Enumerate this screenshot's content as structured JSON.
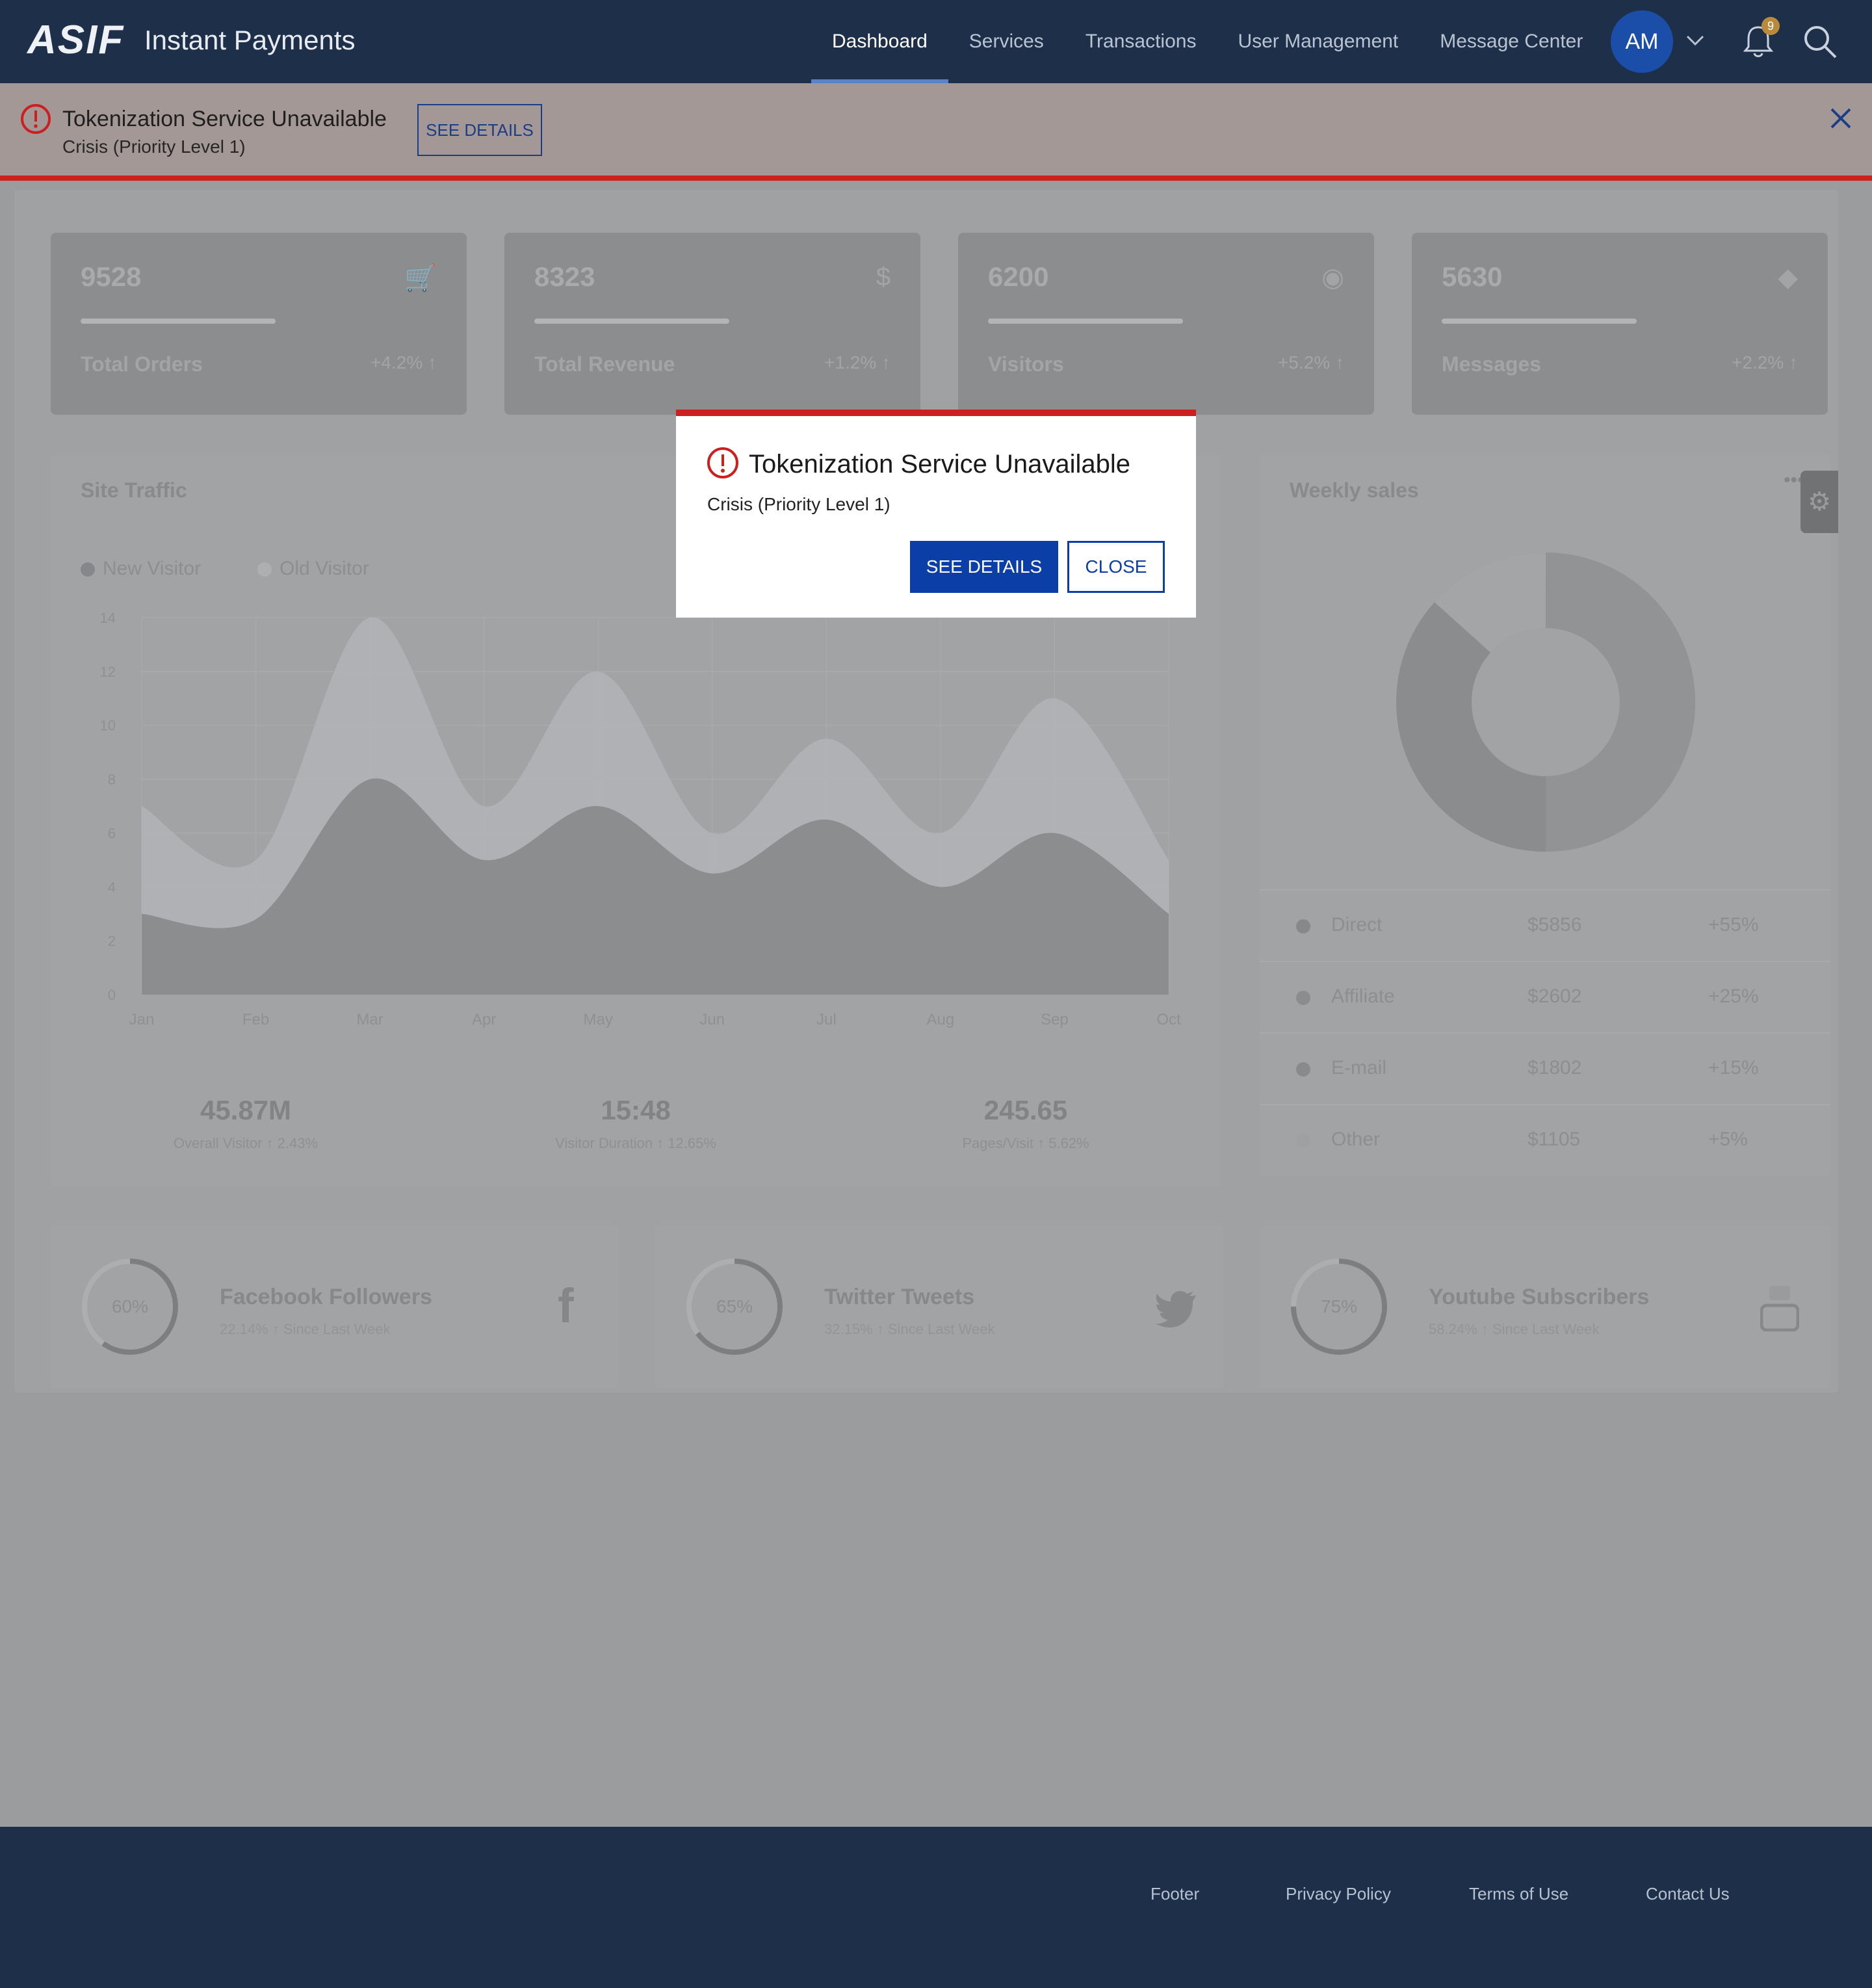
{
  "header": {
    "logo": "ASIF",
    "app_title": "Instant Payments",
    "nav": [
      "Dashboard",
      "Services",
      "Transactions",
      "User Management",
      "Message Center"
    ],
    "active_nav": "Dashboard",
    "avatar_initials": "AM",
    "notification_count": "9"
  },
  "banner": {
    "title": "Tokenization Service Unavailable",
    "subtitle": "Crisis (Priority Level 1)",
    "button": "SEE DETAILS"
  },
  "stats": [
    {
      "value": "9528",
      "label": "Total Orders",
      "change": "+4.2% ↑",
      "icon": "cart-icon"
    },
    {
      "value": "8323",
      "label": "Total Revenue",
      "change": "+1.2% ↑",
      "icon": "dollar-icon"
    },
    {
      "value": "6200",
      "label": "Visitors",
      "change": "+5.2% ↑",
      "icon": "eye-icon"
    },
    {
      "value": "5630",
      "label": "Messages",
      "change": "+2.2% ↑",
      "icon": "tag-icon"
    }
  ],
  "site_traffic": {
    "title": "Site Traffic",
    "legend": [
      "New Visitor",
      "Old Visitor"
    ],
    "summary": [
      {
        "value": "45.87M",
        "label": "Overall Visitor ↑ 2.43%"
      },
      {
        "value": "15:48",
        "label": "Visitor Duration ↑ 12.65%"
      },
      {
        "value": "245.65",
        "label": "Pages/Visit ↑ 5.62%"
      }
    ]
  },
  "chart_data": {
    "type": "area",
    "x": [
      "Jan",
      "Feb",
      "Mar",
      "Apr",
      "May",
      "Jun",
      "Jul",
      "Aug",
      "Sep",
      "Oct"
    ],
    "yticks": [
      0,
      2,
      4,
      6,
      8,
      10,
      12,
      14
    ],
    "ylim": [
      0,
      14
    ],
    "series": [
      {
        "name": "New Visitor",
        "values": [
          3,
          2.8,
          8,
          5,
          7,
          4.5,
          6.5,
          4,
          6,
          3
        ]
      },
      {
        "name": "Old Visitor",
        "values": [
          7,
          5,
          14,
          7,
          12,
          6,
          9.5,
          6,
          11,
          5
        ]
      }
    ]
  },
  "weekly_sales": {
    "title": "Weekly sales",
    "rows": [
      {
        "name": "Direct",
        "amount": "$5856",
        "change": "+55%"
      },
      {
        "name": "Affiliate",
        "amount": "$2602",
        "change": "+25%"
      },
      {
        "name": "E-mail",
        "amount": "$1802",
        "change": "+15%"
      },
      {
        "name": "Other",
        "amount": "$1105",
        "change": "+5%"
      }
    ]
  },
  "social": [
    {
      "percent": "60%",
      "title": "Facebook Followers",
      "sub": "22.14% ↑ Since Last Week"
    },
    {
      "percent": "65%",
      "title": "Twitter Tweets",
      "sub": "32.15% ↑ Since Last Week"
    },
    {
      "percent": "75%",
      "title": "Youtube Subscribers",
      "sub": "58.24% ↑ Since Last Week"
    }
  ],
  "modal": {
    "title": "Tokenization Service Unavailable",
    "subtitle": "Crisis (Priority Level 1)",
    "see_details": "SEE DETAILS",
    "close": "CLOSE"
  },
  "footer": {
    "links": [
      "Footer",
      "Privacy Policy",
      "Terms of Use",
      "Contact Us"
    ]
  },
  "colors": {
    "header_bg": "#1e2f4a",
    "alert_red": "#cc1f1f",
    "primary_blue": "#0b3ea6"
  }
}
